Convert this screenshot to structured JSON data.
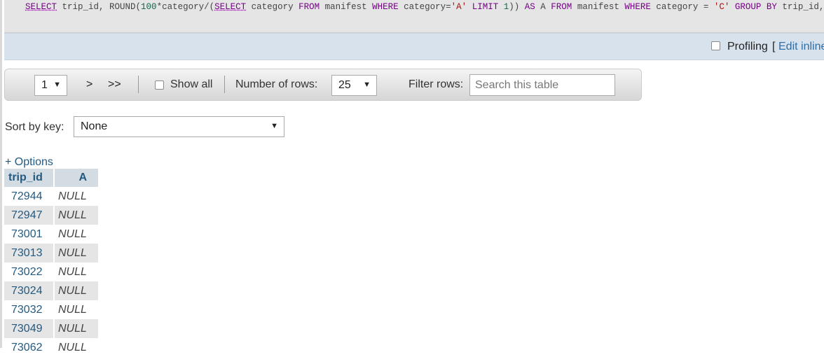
{
  "sql": {
    "tokens": [
      {
        "text": "SELECT",
        "cls": "kwu"
      },
      {
        "text": " trip_id, ROUND(",
        "cls": ""
      },
      {
        "text": "100",
        "cls": "num"
      },
      {
        "text": "*category/(",
        "cls": ""
      },
      {
        "text": "SELECT",
        "cls": "kwu"
      },
      {
        "text": " category ",
        "cls": ""
      },
      {
        "text": "FROM",
        "cls": "kw"
      },
      {
        "text": " manifest ",
        "cls": ""
      },
      {
        "text": "WHERE",
        "cls": "kw"
      },
      {
        "text": " category=",
        "cls": ""
      },
      {
        "text": "'A'",
        "cls": "str"
      },
      {
        "text": " ",
        "cls": ""
      },
      {
        "text": "LIMIT",
        "cls": "kw"
      },
      {
        "text": " ",
        "cls": ""
      },
      {
        "text": "1",
        "cls": "num"
      },
      {
        "text": ")) ",
        "cls": ""
      },
      {
        "text": "AS",
        "cls": "kw"
      },
      {
        "text": " A ",
        "cls": ""
      },
      {
        "text": "FROM",
        "cls": "kw"
      },
      {
        "text": " manifest ",
        "cls": ""
      },
      {
        "text": "WHERE",
        "cls": "kw"
      },
      {
        "text": " category = ",
        "cls": ""
      },
      {
        "text": "'C'",
        "cls": "str"
      },
      {
        "text": " ",
        "cls": ""
      },
      {
        "text": "GROUP BY",
        "cls": "kw"
      },
      {
        "text": " trip_id, A",
        "cls": ""
      }
    ]
  },
  "profiling": {
    "label": "Profiling",
    "bracket": "[",
    "edit_inline": "Edit inline"
  },
  "nav": {
    "page_value": "1",
    "next_label": ">",
    "last_label": ">>",
    "show_all_label": "Show all",
    "rows_label": "Number of rows:",
    "rows_value": "25",
    "filter_label": "Filter rows:",
    "search_placeholder": "Search this table"
  },
  "sort": {
    "label": "Sort by key:",
    "value": "None"
  },
  "options_label": "+ Options",
  "table": {
    "headers": [
      "trip_id",
      "A"
    ],
    "rows": [
      [
        "72944",
        "NULL"
      ],
      [
        "72947",
        "NULL"
      ],
      [
        "73001",
        "NULL"
      ],
      [
        "73013",
        "NULL"
      ],
      [
        "73022",
        "NULL"
      ],
      [
        "73024",
        "NULL"
      ],
      [
        "73032",
        "NULL"
      ],
      [
        "73049",
        "NULL"
      ],
      [
        "73062",
        "NULL"
      ]
    ]
  },
  "icons": {
    "dropdown": "chevron-down-icon",
    "checkbox": "checkbox-icon"
  }
}
